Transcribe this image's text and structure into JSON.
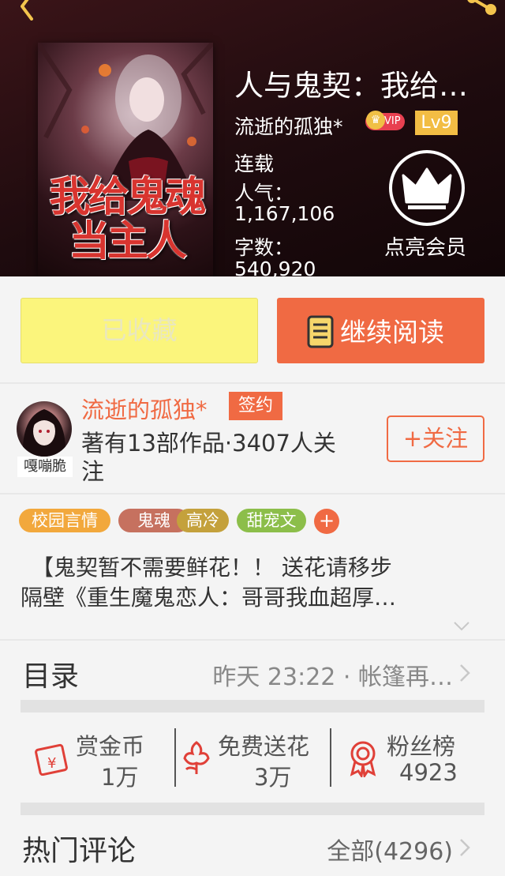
{
  "header": {
    "back_icon": "back-arrow-icon",
    "share_icon": "share-icon"
  },
  "book": {
    "cover_title": "我给鬼魂当主人",
    "title": "人与鬼契：我给…",
    "author": "流逝的孤独*",
    "vip_label": "VIP",
    "level": "Lv9",
    "status": "连载",
    "popularity_label": "人气：",
    "popularity": "1,167,106",
    "word_count_label": "字数：",
    "word_count": "540,920",
    "member_label": "点亮会员"
  },
  "actions": {
    "collected_label": "已收藏",
    "read_label": "继续阅读"
  },
  "author": {
    "avatar_caption": "嘎嘣脆",
    "name": "流逝的孤独*",
    "sign_badge": "签约",
    "stats_line1": "著有13部作品·3407人关",
    "stats_line2": "注",
    "follow_label": "+关注"
  },
  "tags": [
    {
      "label": "校园言情",
      "color": "#f2a83c"
    },
    {
      "label": "鬼魂",
      "color": "#c6715f"
    },
    {
      "label": "高冷",
      "color": "#c4a13c"
    },
    {
      "label": "甜宠文",
      "color": "#8cbe4a"
    }
  ],
  "tag_add": "+",
  "summary": {
    "line1": "　【鬼契暂不需要鲜花！！ 送花请移步",
    "line2": "隔壁《重生魔鬼恋人：哥哥我血超厚…"
  },
  "toc": {
    "label": "目录",
    "latest": "昨天 23:22 · 帐篷再…"
  },
  "stats": [
    {
      "label": "赏金币",
      "value": "1万",
      "icon": "red-envelope-icon"
    },
    {
      "label": "免费送花",
      "value": "3万",
      "icon": "flower-icon"
    },
    {
      "label": "粉丝榜",
      "value": "4923",
      "icon": "medal-icon"
    }
  ],
  "comments": {
    "label": "热门评论",
    "all_label": "全部(4296)"
  },
  "colors": {
    "accent": "#f06a43",
    "collected_bg": "#fbf57c",
    "level_badge": "#f2bd44",
    "vip_badge": "#e84050"
  }
}
